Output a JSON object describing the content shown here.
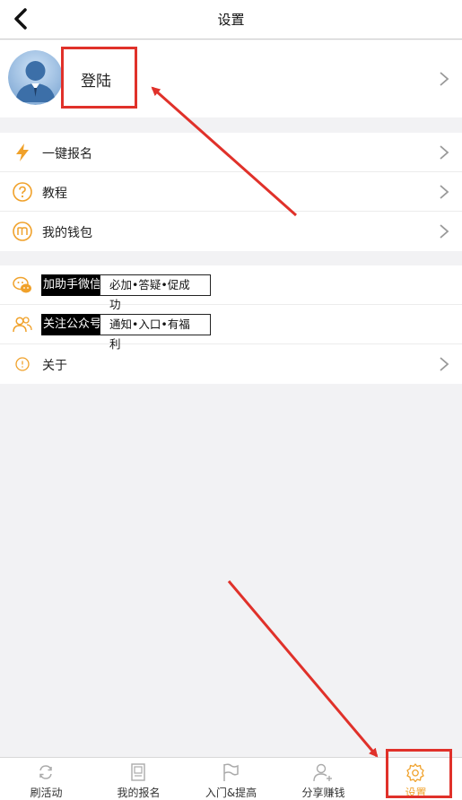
{
  "header": {
    "title": "设置",
    "back_icon": "chevron-left-icon"
  },
  "profile": {
    "login_label": "登陆",
    "avatar_icon": "user-avatar-icon"
  },
  "menu_group_1": [
    {
      "label": "一键报名",
      "icon": "lightning-icon"
    },
    {
      "label": "教程",
      "icon": "question-circle-icon"
    },
    {
      "label": "我的钱包",
      "icon": "wallet-coin-icon"
    }
  ],
  "menu_group_2": {
    "wechat": {
      "label": "加助手微信",
      "tag": "必加•答疑•促成功",
      "icon": "wechat-chat-icon"
    },
    "official": {
      "label": "关注公众号",
      "tag": "通知•入口•有福利",
      "icon": "people-icon"
    },
    "about": {
      "label": "关于",
      "icon": "info-circle-icon"
    }
  },
  "tabbar": {
    "items": [
      {
        "label": "刷活动",
        "icon": "refresh-icon"
      },
      {
        "label": "我的报名",
        "icon": "document-icon"
      },
      {
        "label": "入门&提高",
        "icon": "flag-icon"
      },
      {
        "label": "分享赚钱",
        "icon": "add-user-icon"
      },
      {
        "label": "设置",
        "icon": "gear-icon"
      }
    ],
    "active_index": 4
  },
  "colors": {
    "accent": "#f0a12a",
    "highlight": "#e0312a",
    "background": "#f2f2f4"
  }
}
